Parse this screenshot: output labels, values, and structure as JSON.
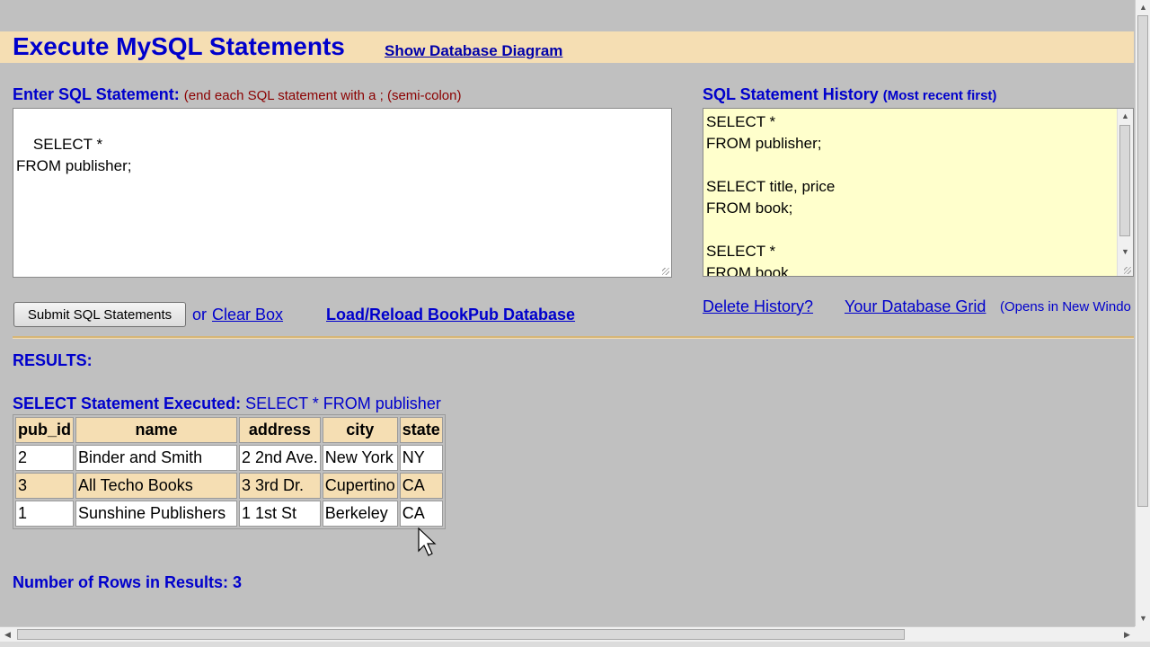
{
  "header": {
    "title": "Execute MySQL Statements",
    "diagram_link": "Show Database Diagram"
  },
  "sql_entry": {
    "label": "Enter SQL Statement:",
    "hint": "(end each SQL statement with a ; (semi-colon)",
    "value": "SELECT *\nFROM publisher;"
  },
  "history": {
    "label": "SQL Statement History",
    "hint": "(Most recent first)",
    "value": "SELECT *\nFROM publisher;\n\nSELECT title, price\nFROM book;\n\nSELECT *\nFROM book",
    "delete_link": "Delete History?",
    "grid_link": "Your Database Grid",
    "grid_note": "(Opens in New Windo"
  },
  "actions": {
    "submit_label": "Submit SQL Statements",
    "or_text": "or",
    "clear_link": "Clear Box",
    "reload_link": "Load/Reload BookPub Database"
  },
  "results": {
    "heading": "RESULTS:",
    "executed_label": "SELECT Statement Executed:",
    "executed_sql": "SELECT * FROM publisher",
    "columns": [
      "pub_id",
      "name",
      "address",
      "city",
      "state"
    ],
    "rows": [
      [
        "2",
        "Binder and Smith",
        "2 2nd Ave.",
        "New York",
        "NY"
      ],
      [
        "3",
        "All Techo Books",
        "3 3rd Dr.",
        "Cupertino",
        "CA"
      ],
      [
        "1",
        "Sunshine Publishers",
        "1 1st St",
        "Berkeley",
        "CA"
      ]
    ],
    "row_count_label": "Number of Rows in Results: 3"
  },
  "colors": {
    "background": "#c0c0c0",
    "accent_band": "#f5deb3",
    "heading_blue": "#0000cc",
    "hint_red": "#8b0000",
    "history_bg": "#ffffcc"
  }
}
